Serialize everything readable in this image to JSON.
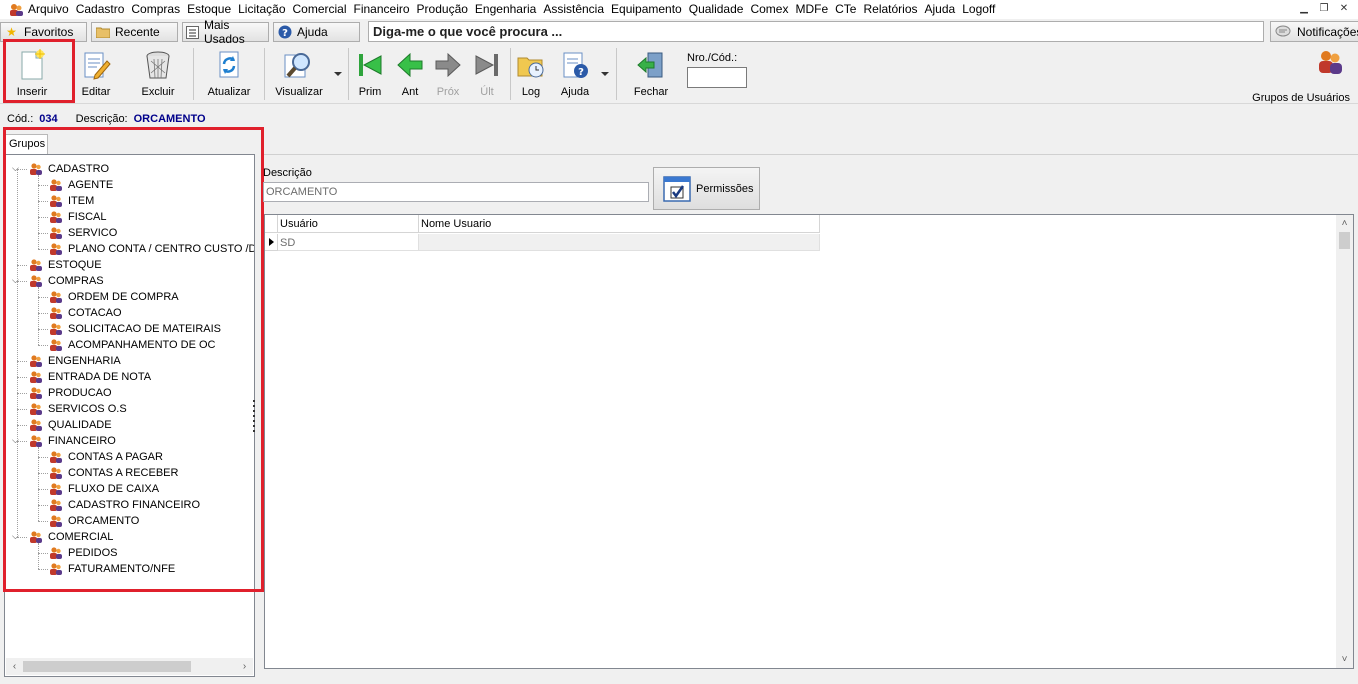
{
  "menu": {
    "items": [
      "Arquivo",
      "Cadastro",
      "Compras",
      "Estoque",
      "Licitação",
      "Comercial",
      "Financeiro",
      "Produção",
      "Engenharia",
      "Assistência",
      "Equipamento",
      "Qualidade",
      "Comex",
      "MDFe",
      "CTe",
      "Relatórios",
      "Ajuda",
      "Logoff"
    ]
  },
  "quickbar": {
    "favoritos": "Favoritos",
    "recente": "Recente",
    "mais_usados": "Mais Usados",
    "ajuda": "Ajuda",
    "search_placeholder": "Diga-me o que você procura ...",
    "notificacoes": "Notificações"
  },
  "toolbar": {
    "inserir": "Inserir",
    "editar": "Editar",
    "excluir": "Excluir",
    "atualizar": "Atualizar",
    "visualizar": "Visualizar",
    "prim": "Prim",
    "ant": "Ant",
    "prox": "Próx",
    "ult": "Últ",
    "log": "Log",
    "ajuda": "Ajuda",
    "fechar": "Fechar",
    "nro_label": "Nro./Cód.:",
    "grupos_usuarios": "Grupos de Usuários"
  },
  "info": {
    "cod_label": "Cód.:",
    "cod_value": "034",
    "desc_label": "Descrição:",
    "desc_value": "ORCAMENTO"
  },
  "grupos": {
    "tab_label": "Grupos",
    "tree": [
      {
        "label": "CADASTRO",
        "level": 0,
        "expanded": true
      },
      {
        "label": "AGENTE",
        "level": 1
      },
      {
        "label": "ITEM",
        "level": 1
      },
      {
        "label": "FISCAL",
        "level": 1
      },
      {
        "label": "SERVICO",
        "level": 1
      },
      {
        "label": "PLANO CONTA / CENTRO CUSTO /DEP",
        "level": 1
      },
      {
        "label": "ESTOQUE",
        "level": 0
      },
      {
        "label": "COMPRAS",
        "level": 0,
        "expanded": true
      },
      {
        "label": "ORDEM DE COMPRA",
        "level": 1
      },
      {
        "label": "COTACAO",
        "level": 1
      },
      {
        "label": "SOLICITACAO DE MATEIRAIS",
        "level": 1
      },
      {
        "label": "ACOMPANHAMENTO DE OC",
        "level": 1
      },
      {
        "label": "ENGENHARIA",
        "level": 0
      },
      {
        "label": "ENTRADA DE NOTA",
        "level": 0
      },
      {
        "label": "PRODUCAO",
        "level": 0
      },
      {
        "label": "SERVICOS O.S",
        "level": 0
      },
      {
        "label": "QUALIDADE",
        "level": 0
      },
      {
        "label": "FINANCEIRO",
        "level": 0,
        "expanded": true
      },
      {
        "label": "CONTAS A PAGAR",
        "level": 1
      },
      {
        "label": "CONTAS A RECEBER",
        "level": 1
      },
      {
        "label": "FLUXO DE CAIXA",
        "level": 1
      },
      {
        "label": "CADASTRO FINANCEIRO",
        "level": 1
      },
      {
        "label": "ORCAMENTO",
        "level": 1
      },
      {
        "label": "COMERCIAL",
        "level": 0,
        "expanded": true
      },
      {
        "label": "PEDIDOS",
        "level": 1
      },
      {
        "label": "FATURAMENTO/NFE",
        "level": 1
      }
    ]
  },
  "detail": {
    "descricao_label": "Descrição",
    "descricao_value": "ORCAMENTO",
    "permissoes_label": "Permissões"
  },
  "grid": {
    "columns": [
      "Usuário",
      "Nome Usuario"
    ],
    "rows": [
      [
        "SD",
        ""
      ]
    ]
  },
  "colors": {
    "highlight_box": "#e0202c",
    "info_value": "#00008b"
  }
}
